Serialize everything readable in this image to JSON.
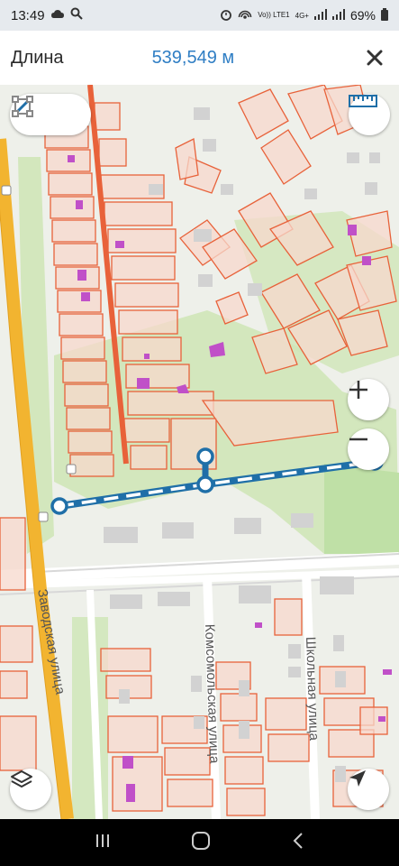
{
  "status": {
    "time": "13:49",
    "battery": "69%",
    "network_label": "Vo)) LTE1",
    "network_gen": "4G+"
  },
  "header": {
    "title": "Длина",
    "value": "539,549 м"
  },
  "map": {
    "street_labels": [
      "Заводская улица",
      "Комсомольская улица",
      "Школьная улица"
    ]
  },
  "colors": {
    "accent": "#2f7ec4",
    "measure_line": "#1f6fa8",
    "parcel_stroke": "#e8623a",
    "parcel_fill": "#f7d8cc",
    "road_main": "#f2b430",
    "green_area": "#cfe6b8"
  },
  "icons": {
    "line_mode": "line-measure-icon",
    "area_mode": "area-measure-icon",
    "ruler": "ruler-icon",
    "zoom_in": "plus-icon",
    "zoom_out": "minus-icon",
    "layers": "layers-icon",
    "location": "navigation-arrow-icon",
    "close": "close-icon"
  }
}
